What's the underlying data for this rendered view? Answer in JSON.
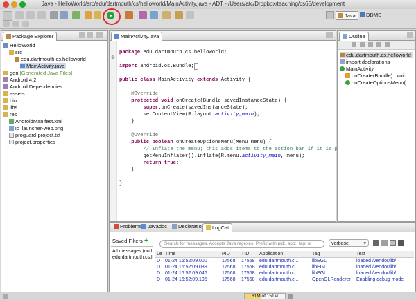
{
  "window": {
    "title": "Java - HelloWorld/src/edu/dartmouth/cs/helloworld/MainActivity.java - ADT - /Users/atc/Dropbox/teaching/cs65/development"
  },
  "perspectives": {
    "java": "Java",
    "ddms": "DDMS"
  },
  "package_explorer": {
    "tab": "Package Explorer",
    "items": [
      {
        "label": "HelloWorld",
        "icon": "project-icon"
      },
      {
        "label": "src",
        "icon": "folder-icon"
      },
      {
        "label": "edu.dartmouth.cs.helloworld",
        "icon": "package-icon"
      },
      {
        "label": "MainActivity.java",
        "icon": "java-file-icon"
      },
      {
        "label": "gen",
        "icon": "folder-icon",
        "suffix": "[Generated Java Files]"
      },
      {
        "label": "Android 4.2",
        "icon": "library-icon"
      },
      {
        "label": "Android Dependencies",
        "icon": "library-icon"
      },
      {
        "label": "assets",
        "icon": "folder-icon"
      },
      {
        "label": "bin",
        "icon": "folder-icon"
      },
      {
        "label": "libs",
        "icon": "folder-icon"
      },
      {
        "label": "res",
        "icon": "folder-icon"
      },
      {
        "label": "AndroidManifest.xml",
        "icon": "xml-file-icon"
      },
      {
        "label": "ic_launcher-web.png",
        "icon": "image-file-icon"
      },
      {
        "label": "proguard-project.txt",
        "icon": "text-file-icon"
      },
      {
        "label": "project.properties",
        "icon": "text-file-icon"
      }
    ]
  },
  "editor": {
    "tab": "MainActivity.java",
    "lines": [
      "package edu.dartmouth.cs.helloworld;",
      "import android.os.Bundle;",
      "public class MainActivity extends Activity {",
      "@Override",
      "protected void onCreate(Bundle savedInstanceState) {",
      "super.onCreate(savedInstanceState);",
      "setContentView(R.layout.activity_main);",
      "}",
      "@Override",
      "public boolean onCreateOptionsMenu(Menu menu) {",
      "// Inflate the menu; this adds items to the action bar if it is pr",
      "getMenuInflater().inflate(R.menu.activity_main, menu);",
      "return true;",
      "}",
      "}"
    ]
  },
  "outline": {
    "tab": "Outline",
    "items": [
      {
        "label": "edu.dartmouth.cs.helloworld"
      },
      {
        "label": "import declarations"
      },
      {
        "label": "MainActivity"
      },
      {
        "label": "onCreate(Bundle) : void"
      },
      {
        "label": "onCreateOptionsMenu("
      }
    ]
  },
  "bottom_tabs": [
    "Problems",
    "Javadoc",
    "Declaration",
    "LogCat"
  ],
  "logcat": {
    "saved_filters_label": "Saved Filters",
    "filter_item": "All messages (no fi",
    "filter_item2": "edu.dartmouth.cs.hel",
    "search_placeholder": "Search for messages. Accepts Java regexes. Prefix with pid:, app:, tag: or",
    "level": "verbose",
    "columns": [
      "Le",
      "Time",
      "PID",
      "TID",
      "Application",
      "Tag",
      "Text"
    ],
    "rows": [
      [
        "D",
        "01-24 16:52:09.000",
        "17568",
        "17568",
        "edu.dartmouth.c...",
        "libEGL",
        "loaded /vendor/lib/"
      ],
      [
        "D",
        "01-24 16:52:09.039",
        "17568",
        "17568",
        "edu.dartmouth.c...",
        "libEGL",
        "loaded /vendor/lib/"
      ],
      [
        "D",
        "01-24 16:52:09.046",
        "17568",
        "17568",
        "edu.dartmouth.c...",
        "libEGL",
        "loaded /vendor/lib/"
      ],
      [
        "D",
        "01-24 16:52:09.195",
        "17568",
        "17568",
        "edu.dartmouth.c...",
        "OpenGLRenderer",
        "Enabling debug mode"
      ]
    ]
  },
  "status": {
    "memory": "61M of 151M",
    "memory_fraction": 0.4
  }
}
